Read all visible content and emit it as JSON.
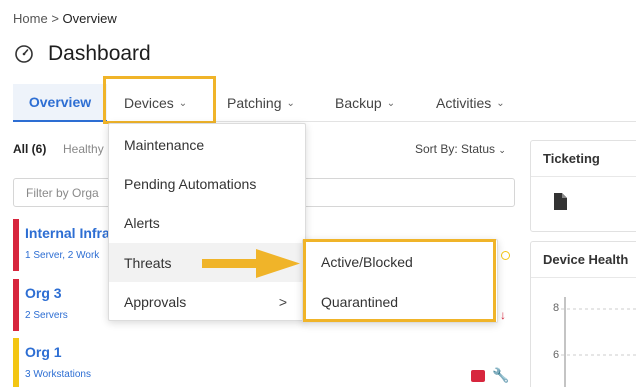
{
  "breadcrumb": {
    "home": "Home",
    "separator": ">",
    "current": "Overview"
  },
  "page": {
    "title": "Dashboard",
    "icon": "gauge-icon"
  },
  "tabs": [
    {
      "label": "Overview"
    },
    {
      "label": "Devices"
    },
    {
      "label": "Patching"
    },
    {
      "label": "Backup"
    },
    {
      "label": "Activities"
    }
  ],
  "filters": {
    "all": "All (6)",
    "healthy": "Healthy",
    "sort_label": "Sort By:",
    "sort_value": "Status"
  },
  "filter_input": {
    "placeholder": "Filter by Orga"
  },
  "orgs": [
    {
      "name": "Internal Infra",
      "sub": "1 Server, 2 Work",
      "color": "#d7263d"
    },
    {
      "name": "Org 3",
      "sub": "2 Servers",
      "color": "#d7263d"
    },
    {
      "name": "Org 1",
      "sub": "3 Workstations",
      "color": "#f3c613"
    }
  ],
  "devices_menu": {
    "items": [
      {
        "label": "Maintenance"
      },
      {
        "label": "Pending Automations"
      },
      {
        "label": "Alerts"
      },
      {
        "label": "Threats"
      },
      {
        "label": "Approvals",
        "arrow": ">"
      }
    ]
  },
  "threats_submenu": {
    "items": [
      {
        "label": "Active/Blocked"
      },
      {
        "label": "Quarantined"
      }
    ]
  },
  "cards": {
    "ticketing": "Ticketing",
    "device_health": "Device Health"
  },
  "chart_data": {
    "type": "line",
    "yticks": [
      "8",
      "6"
    ]
  },
  "colors": {
    "accent": "#2d6ed3",
    "highlight": "#f0b429",
    "critical": "#d7263d",
    "warning": "#f3c613"
  }
}
